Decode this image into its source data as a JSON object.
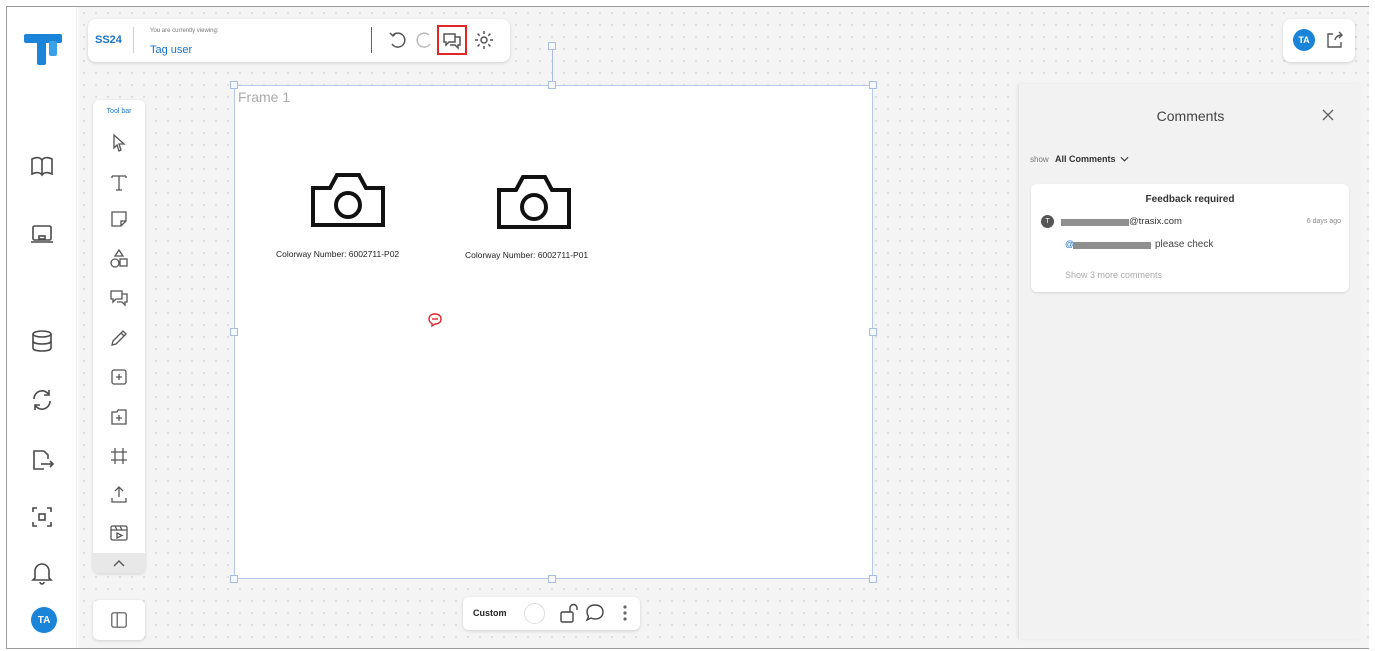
{
  "header": {
    "season": "SS24",
    "viewing_label": "You are currently viewing:",
    "viewing_value": "Tag user"
  },
  "toolbar": {
    "title": "Tool bar"
  },
  "user": {
    "initials": "TA"
  },
  "frame": {
    "title": "Frame 1",
    "items": [
      {
        "caption": "Colorway Number: 6002711-P02"
      },
      {
        "caption": "Colorway Number: 6002711-P01"
      }
    ]
  },
  "bottom_bar": {
    "label": "Custom"
  },
  "comments": {
    "title": "Comments",
    "filter_label": "show",
    "filter_value": "All Comments",
    "thread": {
      "title": "Feedback required",
      "author_initial": "T",
      "email_suffix": "@trasix.com",
      "time": "6 days ago",
      "mention_prefix": "@",
      "message": "please check",
      "more_label": "Show 3 more comments"
    }
  },
  "colors": {
    "accent": "#1a73c9",
    "highlight": "#e0262b",
    "brand_blue": "#1a84d8"
  },
  "icons": [
    "book-icon",
    "laptop-icon",
    "database-icon",
    "sync-icon",
    "export-icon",
    "scan-icon",
    "bell-icon"
  ]
}
